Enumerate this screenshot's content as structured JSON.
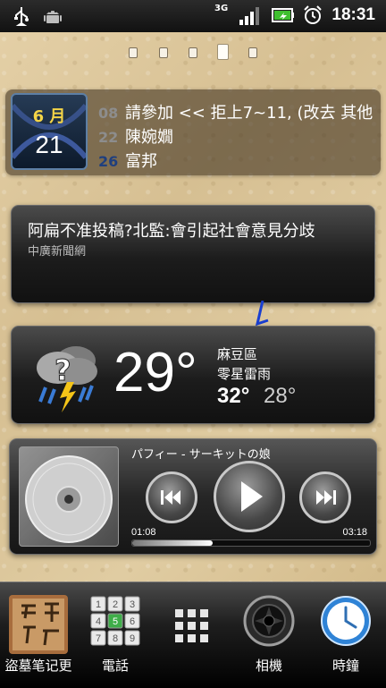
{
  "status_bar": {
    "network_type": "3G",
    "time": "18:31",
    "icons": [
      "usb-icon",
      "android-debug-icon",
      "signal-icon",
      "battery-icon",
      "alarm-icon"
    ]
  },
  "home_pages": {
    "count": 5,
    "active": 4
  },
  "calendar": {
    "month_label": "6 月",
    "day": "21",
    "events": [
      {
        "date": "08",
        "date_color": "#8d8d8d",
        "title": "請參加 << 拒上7~11, (改去 其他"
      },
      {
        "date": "22",
        "date_color": "#8d8d8d",
        "title": "陳婉嫺"
      },
      {
        "date": "26",
        "date_color": "#1f3f7e",
        "title": "富邦"
      }
    ]
  },
  "news": {
    "headline": "阿扁不准投稿?北監:會引起社會意見分歧",
    "source": "中廣新聞網"
  },
  "weather": {
    "temperature": "29°",
    "location": "麻豆區",
    "condition": "零星雷雨",
    "high": "32°",
    "low": "28°",
    "icon": "thunderstorm-icon"
  },
  "music": {
    "song_title": "パフィー - サーキットの娘",
    "elapsed": "01:08",
    "duration": "03:18",
    "progress_fraction": 0.34
  },
  "dock": [
    {
      "label": "盜墓笔记更",
      "icon": "book-app-icon"
    },
    {
      "label": "電話",
      "icon": "dialpad-icon"
    },
    {
      "label": "",
      "icon": "app-drawer-icon"
    },
    {
      "label": "相機",
      "icon": "camera-icon"
    },
    {
      "label": "時鐘",
      "icon": "clock-icon"
    }
  ],
  "colors": {
    "calendar_month": "#f5d547",
    "lightning": "#f5c518",
    "rain": "#3a7bd5"
  }
}
